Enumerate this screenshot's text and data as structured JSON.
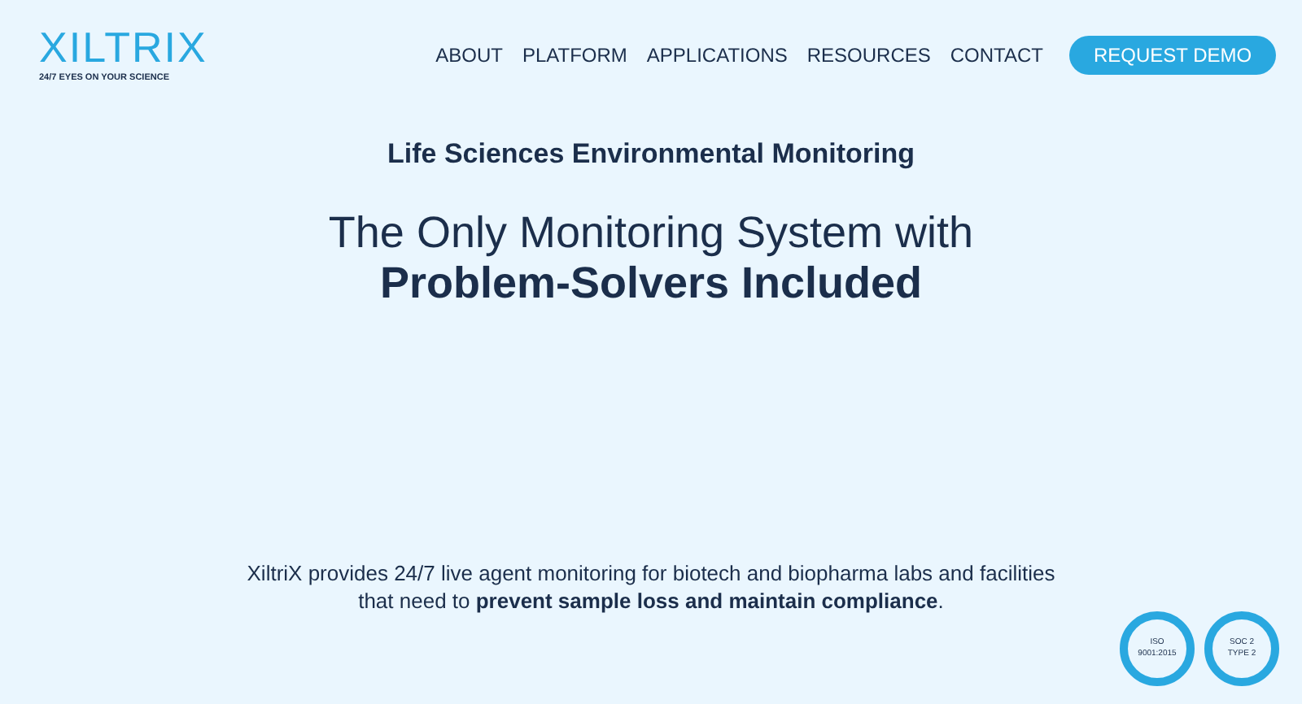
{
  "logo": {
    "name": "XILTRIX",
    "tagline": "24/7 EYES ON YOUR SCIENCE"
  },
  "nav": {
    "items": [
      "ABOUT",
      "PLATFORM",
      "APPLICATIONS",
      "RESOURCES",
      "CONTACT"
    ],
    "cta": "REQUEST DEMO"
  },
  "hero": {
    "eyebrow": "Life Sciences Environmental Monitoring",
    "title_line1": "The Only Monitoring System with",
    "title_line2": "Problem-Solvers Included",
    "description": "XiltriX provides 24/7 live agent monitoring for biotech and biopharma labs and facilities that need to **prevent sample loss and maintain compliance**."
  },
  "badges": [
    {
      "line1": "ISO",
      "line2": "9001:2015"
    },
    {
      "line1": "SOC 2",
      "line2": "TYPE 2"
    }
  ]
}
